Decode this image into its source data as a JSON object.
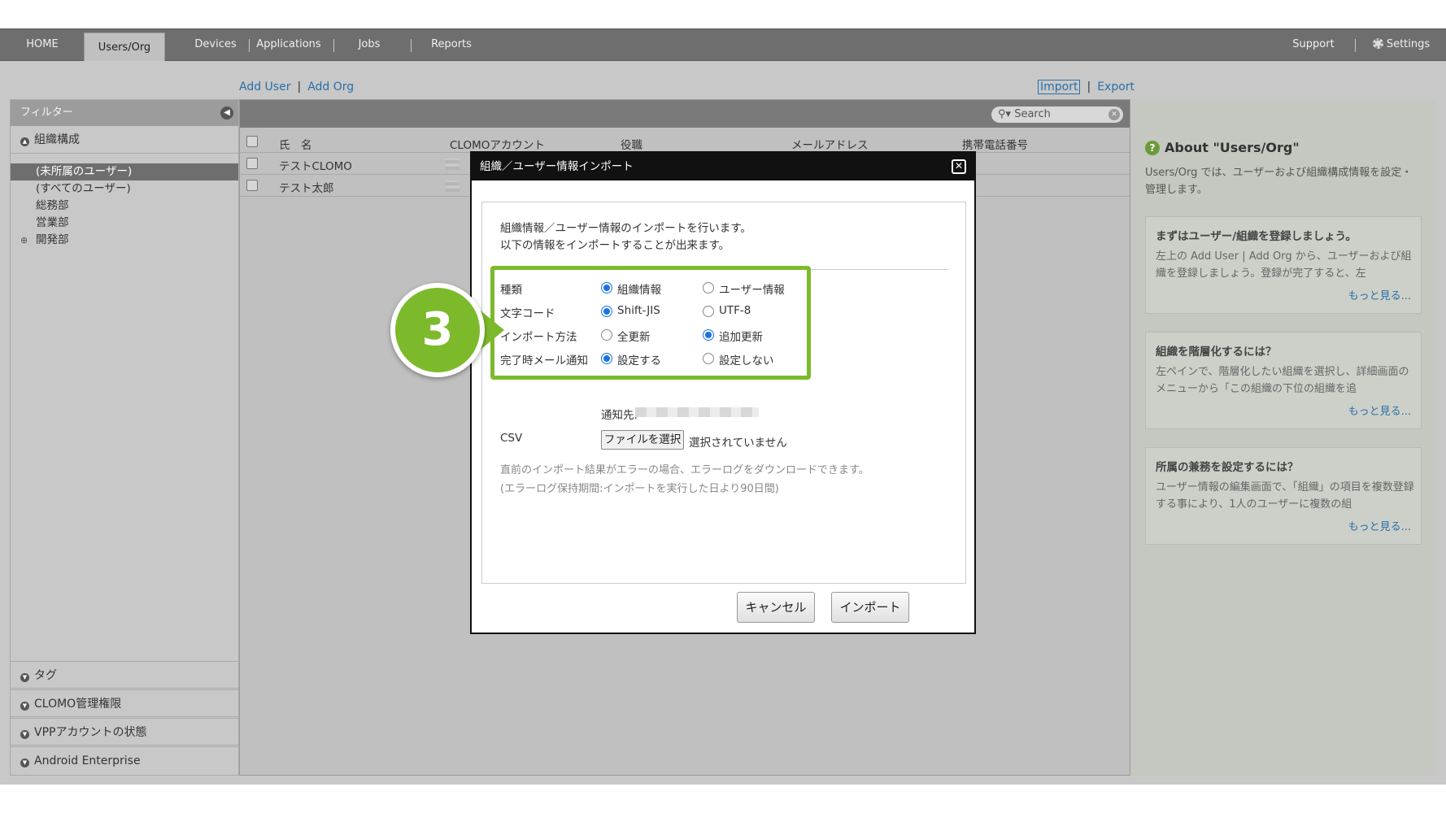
{
  "nav": {
    "tabs": [
      {
        "label": "HOME"
      },
      {
        "label": "Users/Org",
        "active": true
      },
      {
        "label": "Devices"
      },
      {
        "label": "Applications"
      },
      {
        "label": "Jobs"
      },
      {
        "label": "Reports"
      }
    ],
    "support": "Support",
    "settings": "Settings"
  },
  "actions": {
    "add_user": "Add User",
    "add_org": "Add Org",
    "import": "Import",
    "export": "Export"
  },
  "sidebar": {
    "filter_title": "フィルター",
    "org_section": "組織構成",
    "tree": [
      {
        "label": "(未所属のユーザー)",
        "selected": true
      },
      {
        "label": "(すべてのユーザー)"
      },
      {
        "label": "総務部"
      },
      {
        "label": "営業部"
      },
      {
        "label": "開発部",
        "expandable": true
      }
    ],
    "bottom_sections": [
      "タグ",
      "CLOMO管理権限",
      "VPPアカウントの状態",
      "Android Enterprise"
    ]
  },
  "table": {
    "search_placeholder": "Search",
    "columns": [
      "氏　名",
      "CLOMOアカウント",
      "役職",
      "メールアドレス",
      "携帯電話番号"
    ],
    "rows": [
      {
        "name": "テストCLOMO"
      },
      {
        "name": "テスト太郎"
      }
    ]
  },
  "about": {
    "title": "About \"Users/Org\"",
    "description": "Users/Org では、ユーザーおよび組織構成情報を設定・管理します。",
    "cards": [
      {
        "title": "まずはユーザー/組織を登録しましょう。",
        "body": "左上の Add User | Add Org から、ユーザーおよび組織を登録しましょう。登録が完了すると、左",
        "more": "もっと見る..."
      },
      {
        "title": "組織を階層化するには？",
        "body": "左ペインで、階層化したい組織を選択し、詳細画面のメニューから「この組織の下位の組織を追",
        "more": "もっと見る..."
      },
      {
        "title": "所属の兼務を設定するには？",
        "body": "ユーザー情報の編集画面で、「組織」の項目を複数登録する事により、1人のユーザーに複数の組",
        "more": "もっと見る..."
      }
    ]
  },
  "modal": {
    "title": "組織／ユーザー情報インポート",
    "intro_line1": "組織情報／ユーザー情報のインポートを行います。",
    "intro_line2": "以下の情報をインポートすることが出来ます。",
    "fields": [
      {
        "label": "種類",
        "options": [
          "組織情報",
          "ユーザー情報"
        ],
        "selected": 0
      },
      {
        "label": "文字コード",
        "options": [
          "Shift-JIS",
          "UTF-8"
        ],
        "selected": 0
      },
      {
        "label": "インポート方法",
        "options": [
          "全更新",
          "追加更新"
        ],
        "selected": 1
      },
      {
        "label": "完了時メール通知",
        "options": [
          "設定する",
          "設定しない"
        ],
        "selected": 0
      }
    ],
    "notify_label": "通知先:",
    "csv_label": "CSV",
    "file_button": "ファイルを選択",
    "file_status": "選択されていません",
    "error_note_line1": "直前のインポート結果がエラーの場合、エラーログをダウンロードできます。",
    "error_note_line2": "(エラーログ保持期間:インポートを実行した日より90日間)",
    "cancel": "キャンセル",
    "submit": "インポート"
  },
  "step_marker": "3",
  "colors": {
    "highlight": "#7cba2c",
    "link": "#2a6fa8",
    "radio": "#1a73e8"
  }
}
